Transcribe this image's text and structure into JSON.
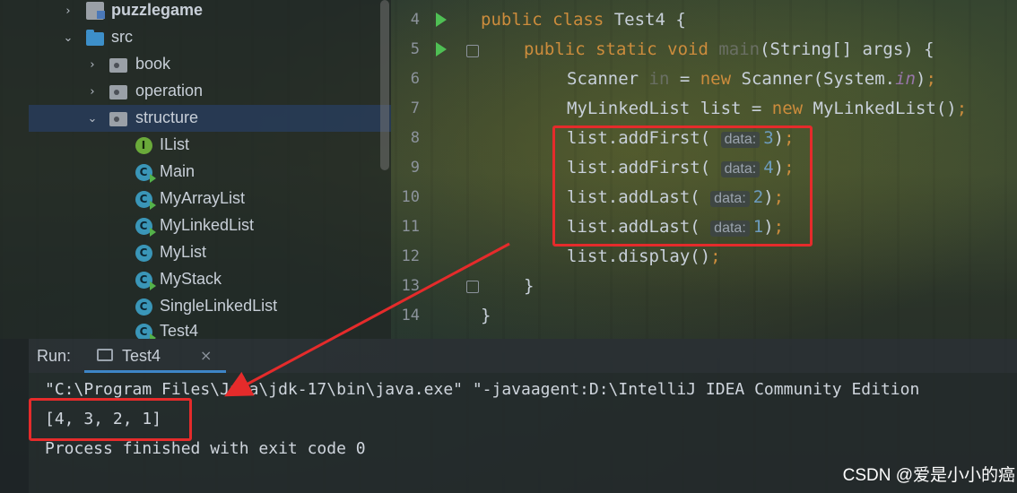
{
  "project_tree": {
    "items": [
      {
        "label": "puzzlegame",
        "icon": "module-icon",
        "chevron": "chevron-right-icon",
        "bold": true
      },
      {
        "label": "src",
        "icon": "folder-icon",
        "chevron": "chevron-down-icon"
      },
      {
        "label": "book",
        "icon": "package-icon",
        "chevron": "chevron-right-icon"
      },
      {
        "label": "operation",
        "icon": "package-icon",
        "chevron": "chevron-right-icon"
      },
      {
        "label": "structure",
        "icon": "package-icon",
        "chevron": "chevron-down-icon",
        "selected": true
      },
      {
        "label": "IList",
        "icon": "interface-icon",
        "icon_letter": "I"
      },
      {
        "label": "Main",
        "icon": "class-icon",
        "icon_letter": "C"
      },
      {
        "label": "MyArrayList",
        "icon": "class-icon",
        "icon_letter": "C"
      },
      {
        "label": "MyLinkedList",
        "icon": "class-icon",
        "icon_letter": "C"
      },
      {
        "label": "MyList",
        "icon": "class-icon",
        "icon_letter": "C"
      },
      {
        "label": "MyStack",
        "icon": "class-icon",
        "icon_letter": "C"
      },
      {
        "label": "SingleLinkedList",
        "icon": "class-icon",
        "icon_letter": "C"
      },
      {
        "label": "Test4",
        "icon": "class-icon",
        "icon_letter": "C"
      }
    ]
  },
  "editor": {
    "line_numbers": [
      "4",
      "5",
      "6",
      "7",
      "8",
      "9",
      "10",
      "11",
      "12",
      "13",
      "14"
    ],
    "line4": {
      "kw": "public class ",
      "rest": "Test4 {"
    },
    "line5": {
      "kw": "public static void ",
      "fn": "main",
      "rest": "(String[] args) {"
    },
    "line6": {
      "a": "Scanner ",
      "b": "in",
      "c": " = ",
      "kw": "new",
      "d": " Scanner(System.",
      "e": "in",
      "f": ")",
      "semi": ";"
    },
    "line7": {
      "a": "MyLinkedList list = ",
      "kw": "new",
      "b": " MyLinkedList()",
      "semi": ";"
    },
    "line8": {
      "call": "list.addFirst(",
      "hint": "data:",
      "val": "3",
      "end": ")",
      "semi": ";"
    },
    "line9": {
      "call": "list.addFirst(",
      "hint": "data:",
      "val": "4",
      "end": ")",
      "semi": ";"
    },
    "line10": {
      "call": "list.addLast(",
      "hint": "data:",
      "val": "2",
      "end": ")",
      "semi": ";"
    },
    "line11": {
      "call": "list.addLast(",
      "hint": "data:",
      "val": "1",
      "end": ")",
      "semi": ";"
    },
    "line12": {
      "call": "list.display()",
      "semi": ";"
    },
    "line13": "}",
    "line14": "}"
  },
  "run_panel": {
    "label": "Run:",
    "tab_label": "Test4",
    "tab_close": "×",
    "console_lines": [
      "\"C:\\Program Files\\Java\\jdk-17\\bin\\java.exe\" \"-javaagent:D:\\IntelliJ IDEA Community Edition",
      "[4, 3, 2, 1]",
      "Process finished with exit code 0"
    ]
  },
  "watermark": "CSDN @爱是小小的癌",
  "colors": {
    "annotation_red": "#e52b2b",
    "keyword": "#cc8c3c",
    "run_green": "#4fbf54",
    "selection": "#283c5a"
  }
}
